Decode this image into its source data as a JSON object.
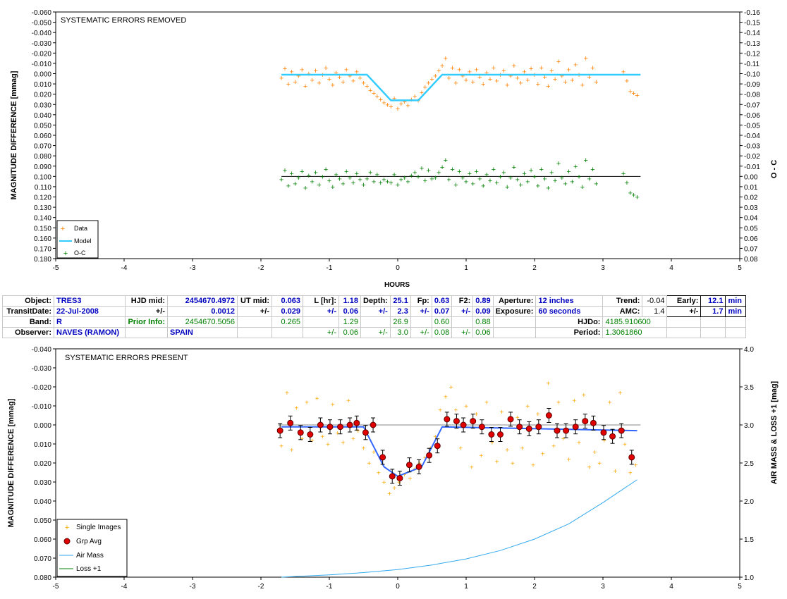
{
  "chart_data": [
    {
      "type": "scatter",
      "title": "SYSTEMATIC ERRORS REMOVED",
      "xlabel": "HOURS",
      "ylabel": "MAGNITUDE DIFFERENCE [mmag]",
      "y2label": "O - C",
      "xlim": [
        -5,
        5
      ],
      "ylim": [
        -0.06,
        0.18
      ],
      "y_inverted": true,
      "y2lim": [
        -0.16,
        0.08
      ],
      "x_ticks": [
        "-5",
        "-4",
        "-3",
        "-2",
        "-1",
        "0",
        "1",
        "2",
        "3",
        "4",
        "5"
      ],
      "y_ticks": [
        "-0.060",
        "-0.050",
        "-0.040",
        "-0.030",
        "-0.020",
        "-0.010",
        "0.000",
        "0.010",
        "0.020",
        "0.030",
        "0.040",
        "0.050",
        "0.060",
        "0.070",
        "0.080",
        "0.090",
        "0.100",
        "0.110",
        "0.120",
        "0.130",
        "0.140",
        "0.150",
        "0.160",
        "0.170",
        "0.180"
      ],
      "y2_ticks": [
        "-0.16",
        "-0.15",
        "-0.14",
        "-0.13",
        "-0.12",
        "-0.11",
        "-0.10",
        "-0.09",
        "-0.08",
        "-0.07",
        "-0.06",
        "-0.05",
        "-0.04",
        "-0.03",
        "-0.02",
        "-0.01",
        "0.00",
        "0.01",
        "0.02",
        "0.03",
        "0.04",
        "0.05",
        "0.06",
        "0.07",
        "0.08"
      ],
      "legend": [
        "Data",
        "Model",
        "O-C"
      ],
      "legend_position": "bottom-left",
      "colors": {
        "data": "#ff8000",
        "model": "#33ccff",
        "oc": "#008000",
        "oc_line": "#000000"
      },
      "model": {
        "x": [
          -1.7,
          -0.45,
          -0.1,
          0.3,
          0.65,
          3.55
        ],
        "y": [
          0.001,
          0.001,
          0.026,
          0.026,
          0.001,
          0.001
        ]
      },
      "data_series": {
        "x": [
          -1.7,
          -1.65,
          -1.6,
          -1.55,
          -1.5,
          -1.45,
          -1.4,
          -1.35,
          -1.3,
          -1.25,
          -1.2,
          -1.15,
          -1.1,
          -1.05,
          -1.0,
          -0.95,
          -0.9,
          -0.85,
          -0.8,
          -0.75,
          -0.7,
          -0.65,
          -0.6,
          -0.55,
          -0.5,
          -0.45,
          -0.4,
          -0.35,
          -0.3,
          -0.25,
          -0.2,
          -0.15,
          -0.1,
          -0.05,
          0.0,
          0.05,
          0.1,
          0.15,
          0.2,
          0.25,
          0.3,
          0.35,
          0.4,
          0.45,
          0.5,
          0.55,
          0.6,
          0.65,
          0.7,
          0.75,
          0.8,
          0.85,
          0.9,
          0.95,
          1.0,
          1.05,
          1.1,
          1.15,
          1.2,
          1.25,
          1.3,
          1.35,
          1.4,
          1.45,
          1.5,
          1.55,
          1.6,
          1.65,
          1.7,
          1.75,
          1.8,
          1.85,
          1.9,
          1.95,
          2.0,
          2.05,
          2.1,
          2.15,
          2.2,
          2.25,
          2.3,
          2.35,
          2.4,
          2.45,
          2.5,
          2.55,
          2.6,
          2.65,
          2.7,
          2.75,
          2.8,
          2.85,
          2.9,
          3.3,
          3.35,
          3.4,
          3.45,
          3.5
        ],
        "y": [
          0.004,
          -0.005,
          0.01,
          -0.002,
          0.008,
          0.002,
          -0.004,
          0.012,
          0.0,
          0.006,
          -0.003,
          0.009,
          0.001,
          -0.006,
          0.005,
          0.011,
          -0.001,
          0.003,
          0.008,
          -0.004,
          0.002,
          0.007,
          -0.002,
          0.004,
          0.009,
          0.012,
          0.016,
          0.019,
          0.022,
          0.025,
          0.028,
          0.03,
          0.032,
          0.024,
          0.034,
          0.029,
          0.027,
          0.031,
          0.025,
          0.022,
          0.026,
          0.018,
          0.013,
          0.009,
          0.005,
          0.002,
          -0.003,
          -0.008,
          -0.015,
          0.004,
          -0.006,
          0.009,
          -0.004,
          0.002,
          0.006,
          -0.002,
          0.008,
          -0.004,
          0.003,
          0.01,
          -0.001,
          0.005,
          -0.006,
          0.007,
          0.001,
          -0.003,
          0.011,
          0.002,
          -0.008,
          0.004,
          0.009,
          -0.002,
          0.006,
          -0.005,
          0.001,
          0.01,
          -0.006,
          0.003,
          0.012,
          -0.003,
          0.005,
          -0.012,
          0.002,
          0.008,
          -0.004,
          0.006,
          -0.009,
          0.001,
          0.011,
          -0.015,
          0.003,
          -0.006,
          0.008,
          -0.002,
          0.007,
          0.017,
          0.019,
          0.021
        ]
      },
      "oc_series": {
        "x": [
          -1.7,
          -1.65,
          -1.6,
          -1.55,
          -1.5,
          -1.45,
          -1.4,
          -1.35,
          -1.3,
          -1.25,
          -1.2,
          -1.15,
          -1.1,
          -1.05,
          -1.0,
          -0.95,
          -0.9,
          -0.85,
          -0.8,
          -0.75,
          -0.7,
          -0.65,
          -0.6,
          -0.55,
          -0.5,
          -0.45,
          -0.4,
          -0.35,
          -0.3,
          -0.25,
          -0.2,
          -0.15,
          -0.1,
          -0.05,
          0.0,
          0.05,
          0.1,
          0.15,
          0.2,
          0.25,
          0.3,
          0.35,
          0.4,
          0.45,
          0.5,
          0.55,
          0.6,
          0.65,
          0.7,
          0.75,
          0.8,
          0.85,
          0.9,
          0.95,
          1.0,
          1.05,
          1.1,
          1.15,
          1.2,
          1.25,
          1.3,
          1.35,
          1.4,
          1.45,
          1.5,
          1.55,
          1.6,
          1.65,
          1.7,
          1.75,
          1.8,
          1.85,
          1.9,
          1.95,
          2.0,
          2.05,
          2.1,
          2.15,
          2.2,
          2.25,
          2.3,
          2.35,
          2.4,
          2.45,
          2.5,
          2.55,
          2.6,
          2.65,
          2.7,
          2.75,
          2.8,
          2.85,
          2.9,
          3.3,
          3.35,
          3.4,
          3.45,
          3.5
        ],
        "y": [
          0.003,
          -0.006,
          0.009,
          -0.003,
          0.007,
          0.001,
          -0.005,
          0.011,
          -0.001,
          0.005,
          -0.004,
          0.008,
          0.0,
          -0.007,
          0.004,
          0.01,
          -0.002,
          0.002,
          0.007,
          -0.005,
          0.001,
          0.006,
          -0.003,
          0.003,
          0.008,
          0.002,
          -0.004,
          0.005,
          -0.002,
          0.006,
          0.003,
          0.005,
          0.006,
          -0.002,
          0.008,
          0.003,
          0.001,
          0.005,
          -0.001,
          -0.004,
          0.0,
          -0.008,
          0.004,
          -0.006,
          0.002,
          0.001,
          -0.004,
          -0.009,
          -0.016,
          0.003,
          -0.007,
          0.008,
          -0.005,
          0.001,
          0.005,
          -0.003,
          0.007,
          -0.005,
          0.002,
          0.009,
          -0.002,
          0.004,
          -0.007,
          0.006,
          0.0,
          -0.004,
          0.01,
          0.001,
          -0.009,
          0.003,
          0.008,
          -0.003,
          0.005,
          -0.006,
          0.0,
          0.009,
          -0.007,
          0.002,
          0.011,
          -0.004,
          0.004,
          -0.013,
          0.001,
          0.007,
          -0.005,
          0.005,
          -0.01,
          0.0,
          0.01,
          -0.016,
          0.002,
          -0.007,
          0.007,
          -0.003,
          0.006,
          0.016,
          0.018,
          0.02
        ]
      }
    },
    {
      "type": "scatter",
      "title": "SYSTEMATIC ERRORS PRESENT",
      "xlabel": "",
      "ylabel": "MAGNITUDE DIFFERENCE [mmag]",
      "y2label": "AIR MASS & LOSS +1 [mag]",
      "xlim": [
        -5,
        5
      ],
      "ylim": [
        -0.04,
        0.08
      ],
      "y_inverted": true,
      "y2lim": [
        1.0,
        4.0
      ],
      "x_ticks": [
        "-5",
        "-4",
        "-3",
        "-2",
        "-1",
        "0",
        "1",
        "2",
        "3",
        "4",
        "5"
      ],
      "y_ticks": [
        "-0.040",
        "-0.030",
        "-0.020",
        "-0.010",
        "0.000",
        "0.010",
        "0.020",
        "0.030",
        "0.040",
        "0.050",
        "0.060",
        "0.070",
        "0.080"
      ],
      "y2_ticks": [
        "4.0",
        "3.5",
        "3.0",
        "2.5",
        "2.0",
        "1.5",
        "1.0"
      ],
      "legend": [
        "Single Images",
        "Grp Avg",
        "Air Mass",
        "Loss +1"
      ],
      "legend_position": "bottom-left",
      "colors": {
        "single": "#ffa500",
        "grp": "#e00000",
        "model": "#3366ff",
        "airmass": "#33aaee",
        "loss": "#008000"
      },
      "model": {
        "x": [
          -1.7,
          -0.5,
          -0.2,
          0.0,
          0.35,
          0.65,
          3.5
        ],
        "y": [
          0.001,
          0.001,
          0.022,
          0.027,
          0.022,
          0.001,
          0.003
        ]
      },
      "grp_avg": {
        "x": [
          -1.72,
          -1.57,
          -1.42,
          -1.28,
          -1.13,
          -0.99,
          -0.84,
          -0.7,
          -0.6,
          -0.47,
          -0.36,
          -0.22,
          -0.08,
          0.03,
          0.17,
          0.31,
          0.46,
          0.58,
          0.72,
          0.86,
          0.96,
          1.1,
          1.23,
          1.37,
          1.5,
          1.65,
          1.78,
          1.92,
          2.06,
          2.21,
          2.33,
          2.46,
          2.6,
          2.74,
          2.86,
          3.01,
          3.14,
          3.27,
          3.42
        ],
        "y": [
          0.003,
          -0.001,
          0.004,
          0.005,
          0.0,
          0.001,
          0.001,
          0.0,
          -0.001,
          0.004,
          0.0,
          0.017,
          0.027,
          0.028,
          0.021,
          0.022,
          0.016,
          0.011,
          -0.003,
          -0.002,
          0.0,
          -0.002,
          0.001,
          0.005,
          0.005,
          -0.003,
          0.001,
          0.002,
          0.001,
          -0.005,
          0.003,
          0.003,
          0.001,
          -0.002,
          -0.001,
          0.004,
          0.006,
          0.003,
          0.017
        ]
      },
      "single_images": {
        "x": [
          -1.7,
          -1.62,
          -1.55,
          -1.48,
          -1.4,
          -1.33,
          -1.25,
          -1.18,
          -1.1,
          -1.02,
          -0.95,
          -0.88,
          -0.8,
          -0.72,
          -0.65,
          -0.58,
          -0.5,
          -0.42,
          -0.35,
          -0.28,
          -0.2,
          -0.12,
          -0.05,
          0.02,
          0.1,
          0.18,
          0.25,
          0.32,
          0.4,
          0.48,
          0.55,
          0.62,
          0.7,
          0.78,
          0.85,
          0.92,
          1.0,
          1.08,
          1.15,
          1.22,
          1.3,
          1.38,
          1.45,
          1.52,
          1.6,
          1.68,
          1.75,
          1.82,
          1.9,
          1.98,
          2.05,
          2.12,
          2.2,
          2.28,
          2.35,
          2.42,
          2.5,
          2.58,
          2.65,
          2.72,
          2.8,
          2.88,
          2.95,
          3.02,
          3.1,
          3.18,
          3.25,
          3.32,
          3.4,
          3.48
        ],
        "y": [
          0.011,
          -0.017,
          0.013,
          -0.009,
          0.007,
          -0.012,
          0.008,
          -0.014,
          0.006,
          0.01,
          -0.011,
          0.004,
          0.009,
          -0.013,
          0.007,
          0.003,
          0.012,
          0.02,
          0.014,
          0.025,
          0.03,
          0.036,
          0.033,
          0.03,
          0.026,
          0.028,
          0.023,
          0.02,
          0.017,
          0.012,
          0.006,
          -0.008,
          -0.015,
          -0.02,
          -0.008,
          0.012,
          -0.01,
          0.022,
          -0.006,
          0.016,
          -0.012,
          0.009,
          0.019,
          -0.007,
          0.013,
          0.02,
          -0.004,
          0.012,
          -0.01,
          0.021,
          -0.006,
          0.015,
          -0.022,
          0.011,
          -0.012,
          0.007,
          0.018,
          -0.013,
          0.009,
          -0.016,
          0.022,
          0.014,
          0.02,
          0.008,
          -0.012,
          0.024,
          -0.017,
          0.01,
          0.025,
          0.021
        ]
      },
      "air_mass": {
        "x": [
          -1.7,
          -1.0,
          -0.5,
          0.0,
          0.5,
          1.0,
          1.5,
          2.0,
          2.5,
          3.0,
          3.2,
          3.4,
          3.5
        ],
        "y2": [
          1.0,
          1.03,
          1.06,
          1.1,
          1.16,
          1.24,
          1.35,
          1.5,
          1.7,
          1.98,
          2.1,
          2.22,
          2.28
        ]
      }
    }
  ],
  "info": {
    "row1": {
      "object_label": "Object:",
      "object": "TRES3",
      "hjd_label": "HJD mid:",
      "hjd": "2454670.4972",
      "ut_label": "UT mid:",
      "ut": "0.063",
      "l_label": "L [hr]:",
      "l": "1.18",
      "depth_label": "Depth:",
      "depth": "25.1",
      "fp_label": "Fp:",
      "fp": "0.63",
      "f2_label": "F2:",
      "f2": "0.89",
      "aperture_label": "Aperture:",
      "aperture": "12 inches",
      "trend_label": "Trend:",
      "trend": "-0.04",
      "early_label": "Early:",
      "early": "12.1",
      "early_unit": "min"
    },
    "row2": {
      "date_label": "TransitDate:",
      "date": "22-Jul-2008",
      "pm_label": "+/-",
      "hjd_err": "0.0012",
      "ut_pm": "+/-",
      "ut_err": "0.029",
      "l_pm": "+/-",
      "l_err": "0.06",
      "depth_pm": "+/-",
      "depth_err": "2.3",
      "fp_pm": "+/-",
      "fp_err": "0.07",
      "f2_pm": "+/-",
      "f2_err": "0.09",
      "exposure_label": "Exposure:",
      "exposure": "60 seconds",
      "amc_label": "AMC:",
      "amc": "1.4",
      "early_pm": "+/-",
      "early_err": "1.7",
      "early_unit": "min"
    },
    "row3": {
      "band_label": "Band:",
      "band": "R",
      "prior_label": "Prior Info:",
      "prior_hjd": "2454670.5056",
      "prior_ut": "0.265",
      "prior_l": "1.29",
      "prior_depth": "26.9",
      "prior_fp": "0.60",
      "prior_f2": "0.88",
      "hjdo_label": "HJDo:",
      "hjdo": "4185.910600"
    },
    "row4": {
      "observer_label": "Observer:",
      "observer": "NAVES (RAMON)",
      "location": "SPAIN",
      "l_pm": "+/-",
      "l_err": "0.06",
      "depth_pm": "+/-",
      "depth_err": "3.0",
      "fp_pm": "+/-",
      "fp_err": "0.08",
      "f2_pm": "+/-",
      "f2_err": "0.06",
      "period_label": "Period:",
      "period": "1.3061860"
    }
  }
}
